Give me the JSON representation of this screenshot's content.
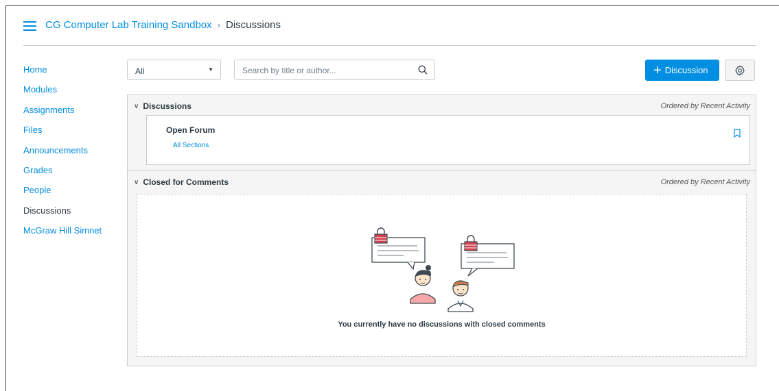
{
  "header": {
    "menu_icon": "hamburger-icon",
    "course_name": "CG Computer Lab Training Sandbox",
    "separator": "›",
    "current_page": "Discussions"
  },
  "sidebar": {
    "items": [
      {
        "label": "Home",
        "active": false
      },
      {
        "label": "Modules",
        "active": false
      },
      {
        "label": "Assignments",
        "active": false
      },
      {
        "label": "Files",
        "active": false
      },
      {
        "label": "Announcements",
        "active": false
      },
      {
        "label": "Grades",
        "active": false
      },
      {
        "label": "People",
        "active": false
      },
      {
        "label": "Discussions",
        "active": true
      },
      {
        "label": "McGraw Hill Simnet",
        "active": false
      }
    ]
  },
  "toolbar": {
    "filter_value": "All",
    "search_placeholder": "Search by title or author...",
    "add_discussion_label": "Discussion",
    "settings_icon": "gear-icon"
  },
  "groups": {
    "discussions": {
      "title": "Discussions",
      "ordering": "Ordered by Recent Activity",
      "topics": [
        {
          "title": "Open Forum",
          "sections": "All Sections"
        }
      ]
    },
    "closed": {
      "title": "Closed for Comments",
      "ordering": "Ordered by Recent Activity",
      "empty_message": "You currently have no discussions with closed comments"
    }
  },
  "colors": {
    "accent": "#008ee2",
    "text": "#2d3b45",
    "border": "#c7cdd1",
    "lock_red": "#d1424e"
  }
}
